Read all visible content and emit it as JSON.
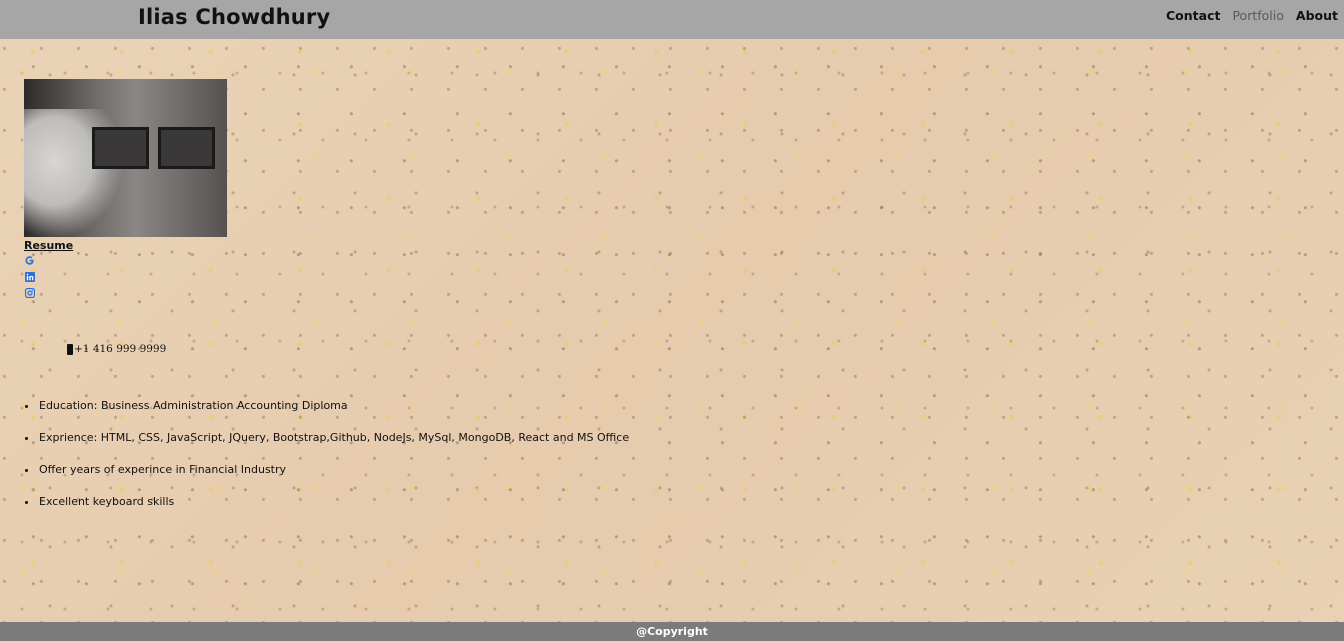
{
  "header": {
    "title": "Ilias Chowdhury",
    "nav": [
      {
        "label": "Contact"
      },
      {
        "label": "Portfolio"
      },
      {
        "label": "About"
      }
    ]
  },
  "profile": {
    "resume_label": "Resume",
    "social_icons": [
      "google-icon",
      "linkedin-icon",
      "instagram-icon"
    ],
    "phone": "+1 416 999 9999"
  },
  "skills": [
    "Education: Business Administration Accounting Diploma",
    "Exprience: HTML, CSS, JavaScript, JQuery, Bootstrap,Github, NodeJs, MySql, MongoDB, React and MS Office",
    "Offer years of experince in Financial Industry",
    "Excellent keyboard skills"
  ],
  "footer": {
    "copyright": "@Copyright"
  },
  "colors": {
    "topbar": "#a6a6a6",
    "footer": "#7b7b7b",
    "icon_blue": "#2a6fdb"
  }
}
